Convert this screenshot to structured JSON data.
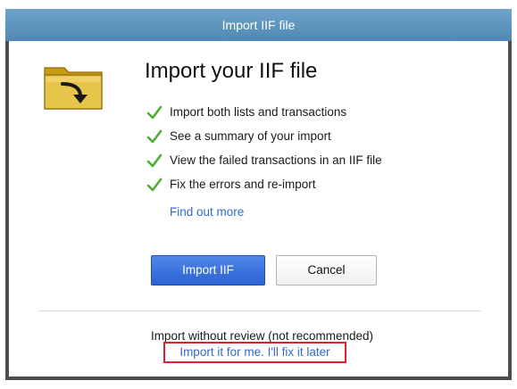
{
  "window": {
    "title": "Import IIF file"
  },
  "header": {
    "icon": "folder-import-icon",
    "heading": "Import your IIF file"
  },
  "features": [
    {
      "icon": "check-icon",
      "label": "Import both lists and transactions"
    },
    {
      "icon": "check-icon",
      "label": "See a summary of your import"
    },
    {
      "icon": "check-icon",
      "label": "View the failed transactions in an IIF file"
    },
    {
      "icon": "check-icon",
      "label": "Fix the errors and re-import"
    }
  ],
  "links": {
    "find_out_more": "Find out more"
  },
  "buttons": {
    "import_label": "Import IIF",
    "cancel_label": "Cancel"
  },
  "footer": {
    "note": "Import without review (not recommended)",
    "import_later_link": "Import it for me. I'll fix it later"
  },
  "colors": {
    "titlebar": "#5b93bd",
    "primary_button": "#3a6fdc",
    "link": "#2f6bc7",
    "check": "#4caf2f",
    "highlight_border": "#e0202a",
    "folder": "#d9b42a"
  }
}
